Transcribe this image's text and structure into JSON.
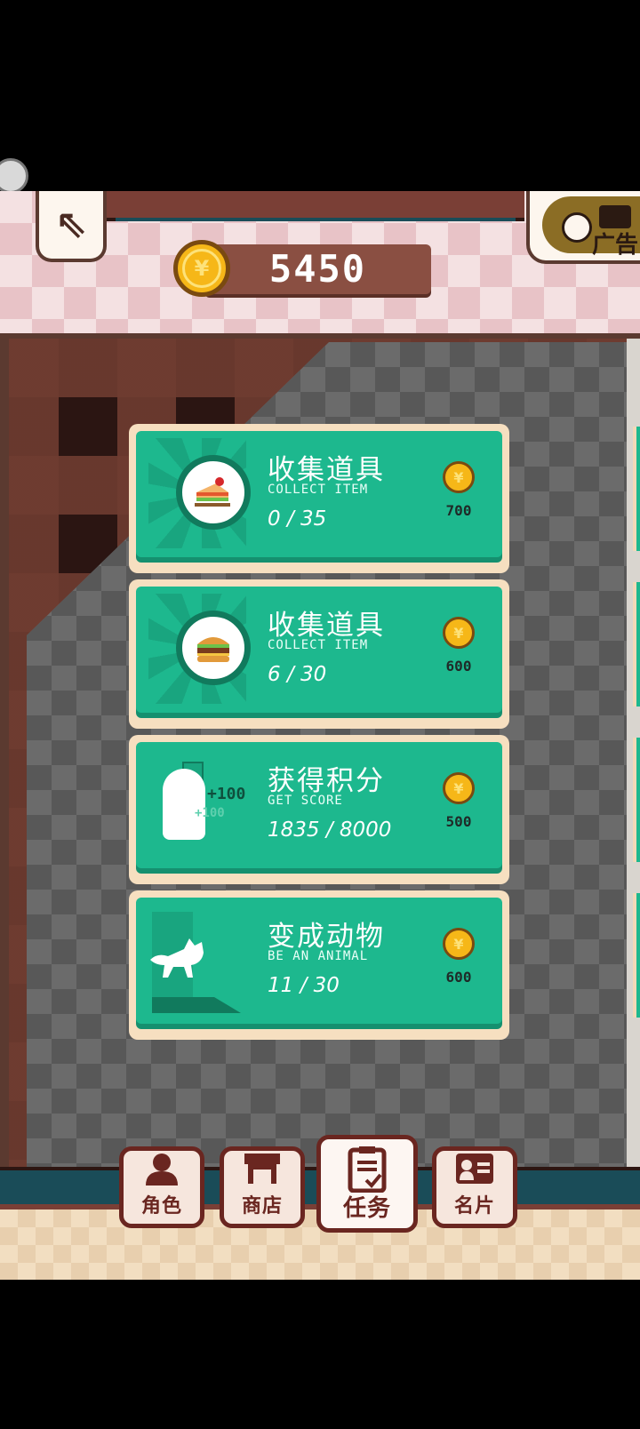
{
  "header": {
    "coins": "5450",
    "ad_label": "广告",
    "home_icon": "arrow-up-left-icon"
  },
  "missions": [
    {
      "title": "收集道具",
      "subtitle": "COLLECT ITEM",
      "progress": "0 / 35",
      "reward": "700",
      "icon": "sandwich-cake-icon"
    },
    {
      "title": "收集道具",
      "subtitle": "COLLECT ITEM",
      "progress": "6 / 30",
      "reward": "600",
      "icon": "burger-icon"
    },
    {
      "title": "获得积分",
      "subtitle": "GET SCORE",
      "progress": "1835 / 8000",
      "reward": "500",
      "icon": "runner-score-icon",
      "float_text": "+100",
      "float_text_2": "+100"
    },
    {
      "title": "变成动物",
      "subtitle": "BE AN ANIMAL",
      "progress": "11 / 30",
      "reward": "600",
      "icon": "cat-silhouette-icon"
    }
  ],
  "nav": [
    {
      "label": "角色",
      "icon": "person-icon"
    },
    {
      "label": "商店",
      "icon": "shop-icon"
    },
    {
      "label": "任务",
      "icon": "clipboard-icon",
      "active": true
    },
    {
      "label": "名片",
      "icon": "id-card-icon"
    }
  ],
  "colors": {
    "card_green": "#1db88e",
    "coin_gold": "#f6b718",
    "nav_border": "#6a2620"
  }
}
